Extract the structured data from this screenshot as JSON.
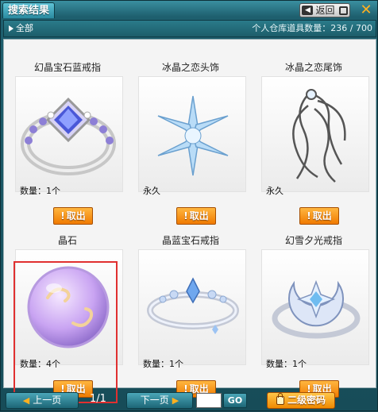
{
  "window": {
    "title": "搜索结果",
    "back_label": "返回",
    "close_glyph": "✕"
  },
  "subheader": {
    "category": "全部",
    "capacity_text": "个人仓库道具数量：236 / 700"
  },
  "items": [
    {
      "name": "幻晶宝石蓝戒指",
      "qty": "数量：1个",
      "take_label": "取出",
      "icon": "ring-blue-gem-icon"
    },
    {
      "name": "冰晶之恋头饰",
      "qty": "永久",
      "take_label": "取出",
      "icon": "ice-crystal-headwear-icon"
    },
    {
      "name": "冰晶之恋尾饰",
      "qty": "永久",
      "take_label": "取出",
      "icon": "ice-crystal-tail-icon"
    },
    {
      "name": "晶石",
      "qty": "数量：4个",
      "take_label": "取出",
      "icon": "crystal-orb-icon"
    },
    {
      "name": "晶蓝宝石戒指",
      "qty": "数量：1个",
      "take_label": "取出",
      "icon": "ring-crystal-blue-icon"
    },
    {
      "name": "幻雪夕光戒指",
      "qty": "数量：1个",
      "take_label": "取出",
      "icon": "ring-moon-star-icon"
    }
  ],
  "pagination": {
    "prev_label": "上一页",
    "page_info": "1/1",
    "next_label": "下一页",
    "go_label": "GO",
    "page_input_value": ""
  },
  "password_button_label": "二级密码",
  "colors": {
    "accent": "#f07a00",
    "frame": "#1e5f6e",
    "highlight": "#e03030"
  }
}
